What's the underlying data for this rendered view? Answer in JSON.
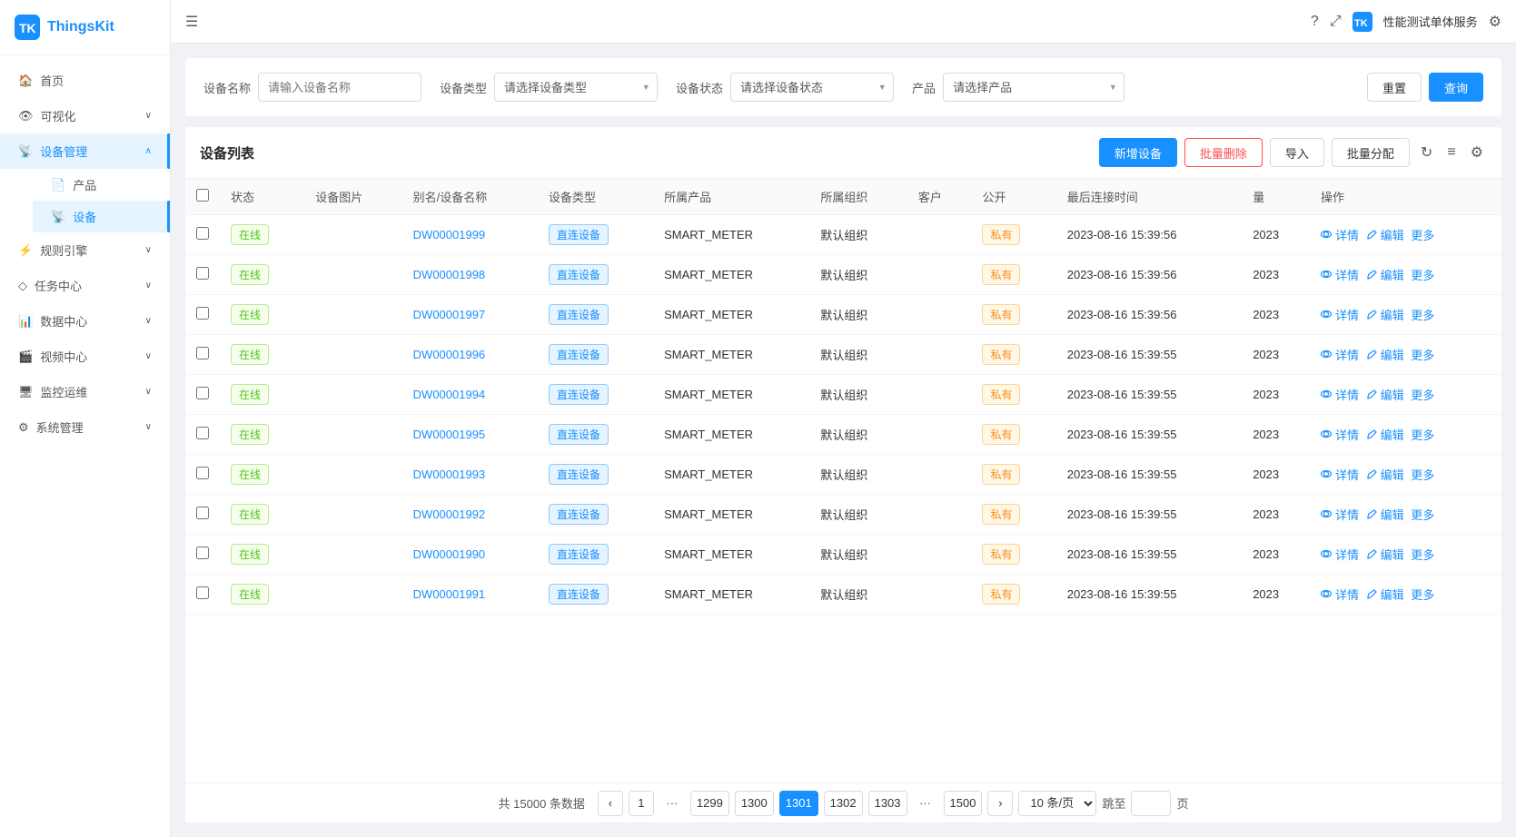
{
  "app": {
    "name": "ThingsKit",
    "service": "性能测试单体服务"
  },
  "topbar": {
    "menu_icon": "☰",
    "help_icon": "?",
    "fullscreen_icon": "⤢",
    "settings_icon": "⚙",
    "brand_icon": "TK"
  },
  "sidebar": {
    "items": [
      {
        "id": "home",
        "label": "首页",
        "icon": "🏠",
        "expandable": false
      },
      {
        "id": "visualization",
        "label": "可视化",
        "icon": "👁",
        "expandable": true
      },
      {
        "id": "device-mgmt",
        "label": "设备管理",
        "icon": "📡",
        "expandable": true,
        "active": true
      },
      {
        "id": "product",
        "label": "产品",
        "icon": "📄",
        "sub": true
      },
      {
        "id": "device",
        "label": "设备",
        "icon": "📡",
        "sub": true,
        "active": true
      },
      {
        "id": "rule-engine",
        "label": "规则引擎",
        "icon": "⚡",
        "expandable": true
      },
      {
        "id": "task-center",
        "label": "任务中心",
        "icon": "◇",
        "expandable": true
      },
      {
        "id": "data-center",
        "label": "数据中心",
        "icon": "📊",
        "expandable": true
      },
      {
        "id": "video-center",
        "label": "视频中心",
        "icon": "🎬",
        "expandable": true
      },
      {
        "id": "monitor",
        "label": "监控运维",
        "icon": "🖥",
        "expandable": true
      },
      {
        "id": "sys-mgmt",
        "label": "系统管理",
        "icon": "⚙",
        "expandable": true
      }
    ]
  },
  "filter": {
    "device_name_label": "设备名称",
    "device_name_placeholder": "请输入设备名称",
    "device_type_label": "设备类型",
    "device_type_placeholder": "请选择设备类型",
    "device_status_label": "设备状态",
    "device_status_placeholder": "请选择设备状态",
    "product_label": "产品",
    "product_placeholder": "请选择产品",
    "reset_btn": "重置",
    "query_btn": "查询"
  },
  "table": {
    "title": "设备列表",
    "add_btn": "新增设备",
    "batch_delete_btn": "批量删除",
    "import_btn": "导入",
    "batch_assign_btn": "批量分配",
    "columns": [
      "状态",
      "设备图片",
      "别名/设备名称",
      "设备类型",
      "所属产品",
      "所属组织",
      "客户",
      "公开",
      "最后连接时间",
      "量",
      "操作"
    ],
    "rows": [
      {
        "status": "在线",
        "name": "DW00001999",
        "device_type": "直连设备",
        "product": "SMART_METER",
        "org": "默认组织",
        "customer": "",
        "public": "私有",
        "last_conn": "2023-08-16 15:39:56",
        "val": "2023"
      },
      {
        "status": "在线",
        "name": "DW00001998",
        "device_type": "直连设备",
        "product": "SMART_METER",
        "org": "默认组织",
        "customer": "",
        "public": "私有",
        "last_conn": "2023-08-16 15:39:56",
        "val": "2023"
      },
      {
        "status": "在线",
        "name": "DW00001997",
        "device_type": "直连设备",
        "product": "SMART_METER",
        "org": "默认组织",
        "customer": "",
        "public": "私有",
        "last_conn": "2023-08-16 15:39:56",
        "val": "2023"
      },
      {
        "status": "在线",
        "name": "DW00001996",
        "device_type": "直连设备",
        "product": "SMART_METER",
        "org": "默认组织",
        "customer": "",
        "public": "私有",
        "last_conn": "2023-08-16 15:39:55",
        "val": "2023"
      },
      {
        "status": "在线",
        "name": "DW00001994",
        "device_type": "直连设备",
        "product": "SMART_METER",
        "org": "默认组织",
        "customer": "",
        "public": "私有",
        "last_conn": "2023-08-16 15:39:55",
        "val": "2023"
      },
      {
        "status": "在线",
        "name": "DW00001995",
        "device_type": "直连设备",
        "product": "SMART_METER",
        "org": "默认组织",
        "customer": "",
        "public": "私有",
        "last_conn": "2023-08-16 15:39:55",
        "val": "2023"
      },
      {
        "status": "在线",
        "name": "DW00001993",
        "device_type": "直连设备",
        "product": "SMART_METER",
        "org": "默认组织",
        "customer": "",
        "public": "私有",
        "last_conn": "2023-08-16 15:39:55",
        "val": "2023"
      },
      {
        "status": "在线",
        "name": "DW00001992",
        "device_type": "直连设备",
        "product": "SMART_METER",
        "org": "默认组织",
        "customer": "",
        "public": "私有",
        "last_conn": "2023-08-16 15:39:55",
        "val": "2023"
      },
      {
        "status": "在线",
        "name": "DW00001990",
        "device_type": "直连设备",
        "product": "SMART_METER",
        "org": "默认组织",
        "customer": "",
        "public": "私有",
        "last_conn": "2023-08-16 15:39:55",
        "val": "2023"
      },
      {
        "status": "在线",
        "name": "DW00001991",
        "device_type": "直连设备",
        "product": "SMART_METER",
        "org": "默认组织",
        "customer": "",
        "public": "私有",
        "last_conn": "2023-08-16 15:39:55",
        "val": "2023"
      }
    ],
    "op_detail": "详情",
    "op_edit": "编辑",
    "op_more": "更多"
  },
  "pagination": {
    "total_info": "共 15000 条数据",
    "prev": "‹",
    "next": "›",
    "pages": [
      "1",
      "...",
      "1299",
      "1300",
      "1301",
      "1302",
      "1303",
      "...",
      "1500"
    ],
    "current": "1301",
    "per_page": "10 条/页",
    "goto_label": "跳至",
    "page_suffix": "页"
  }
}
